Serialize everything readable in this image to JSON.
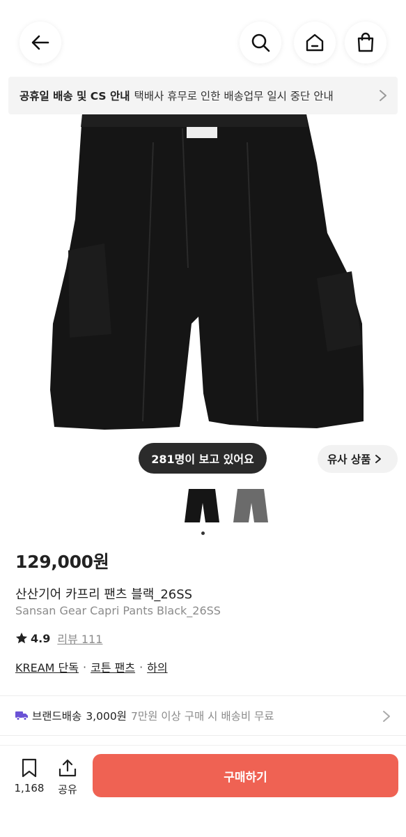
{
  "header": {
    "back_icon": "arrow-left-icon",
    "search_icon": "search-icon",
    "home_icon": "home-icon",
    "bag_icon": "shopping-bag-icon"
  },
  "notice": {
    "strong": "공휴일 배송 및 CS 안내",
    "text": "택배사 휴무로 인한 배송업무 일시 중단 안내"
  },
  "product": {
    "viewers": "281명이 보고 있어요",
    "similar": "유사 상품",
    "price": "129,000원",
    "name_ko": "산산기어 카프리 팬츠 블랙_26SS",
    "name_en": "Sansan Gear Capri Pants Black_26SS",
    "rating": "4.9",
    "reviews": "리뷰 111",
    "tags": [
      "KREAM 단독",
      "코튼 팬츠",
      "하의"
    ],
    "thumbnail_colors": [
      "#1a1a1a",
      "#6b6b6b"
    ]
  },
  "shipping": {
    "label": "브랜드배송",
    "fee": "3,000원",
    "note": "7만원 이상 구매 시 배송비 무료"
  },
  "bottom": {
    "bookmark_count": "1,168",
    "share_label": "공유",
    "buy_label": "구매하기"
  },
  "colors": {
    "accent": "#ef6253",
    "shipping_truck": "#6a52d6"
  }
}
